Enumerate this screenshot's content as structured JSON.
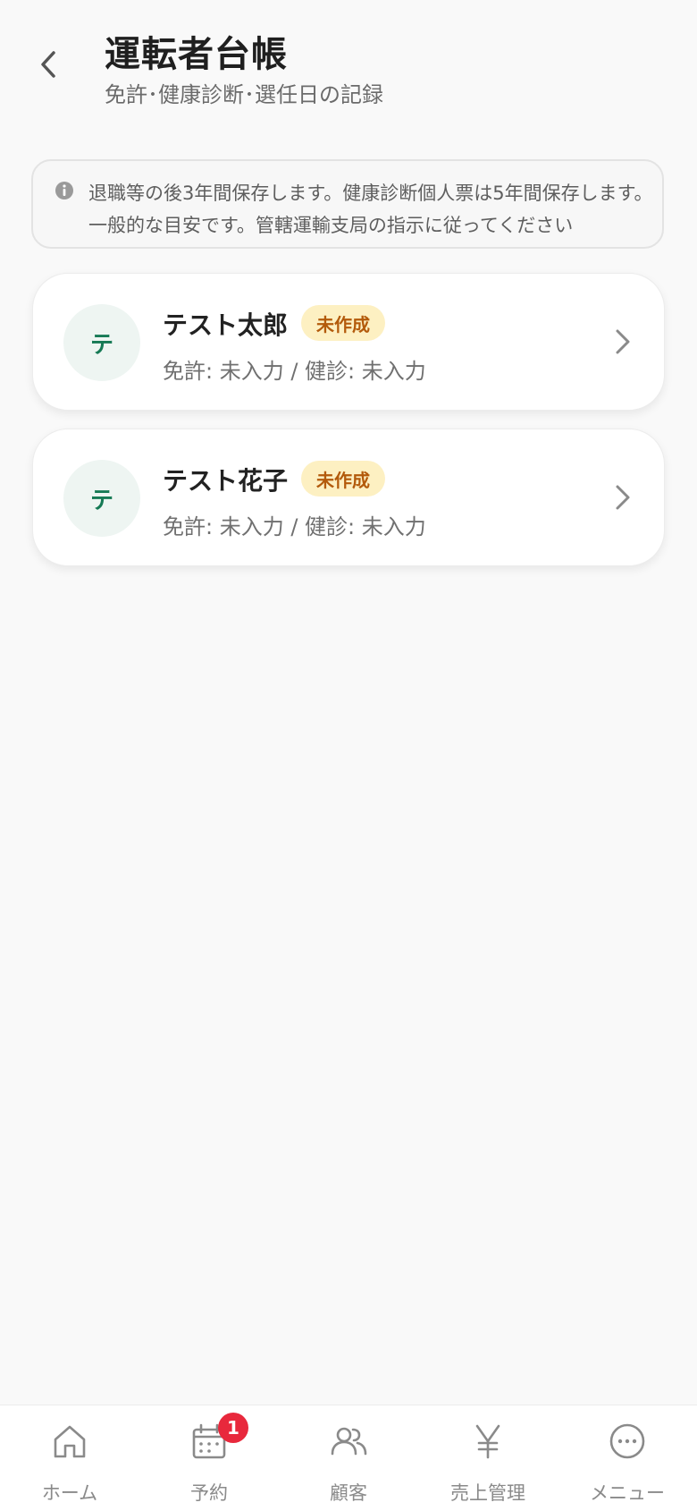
{
  "header": {
    "title": "運転者台帳",
    "subtitle": "免許･健康診断･選任日の記録",
    "back_icon": "chevron-left-icon"
  },
  "notice": {
    "icon": "info-icon",
    "line1": "退職等の後3年間保存します。健康診断個人票は5年間保存します。",
    "line2": "一般的な目安です。管轄運輸支局の指示に従ってください"
  },
  "drivers": [
    {
      "initial": "テ",
      "name": "テスト太郎",
      "status": "未作成",
      "meta": "免許: 未入力 / 健診: 未入力"
    },
    {
      "initial": "テ",
      "name": "テスト花子",
      "status": "未作成",
      "meta": "免許: 未入力 / 健診: 未入力"
    }
  ],
  "nav": [
    {
      "label": "ホーム",
      "icon": "home-icon"
    },
    {
      "label": "予約",
      "icon": "calendar-icon",
      "badge": "1"
    },
    {
      "label": "顧客",
      "icon": "users-icon"
    },
    {
      "label": "売上管理",
      "icon": "yen-icon"
    },
    {
      "label": "メニュー",
      "icon": "more-icon"
    }
  ],
  "colors": {
    "accent": "#167a55",
    "badge_bg": "#fdf0c2",
    "badge_text": "#b35a0b",
    "notification": "#e8283c"
  }
}
